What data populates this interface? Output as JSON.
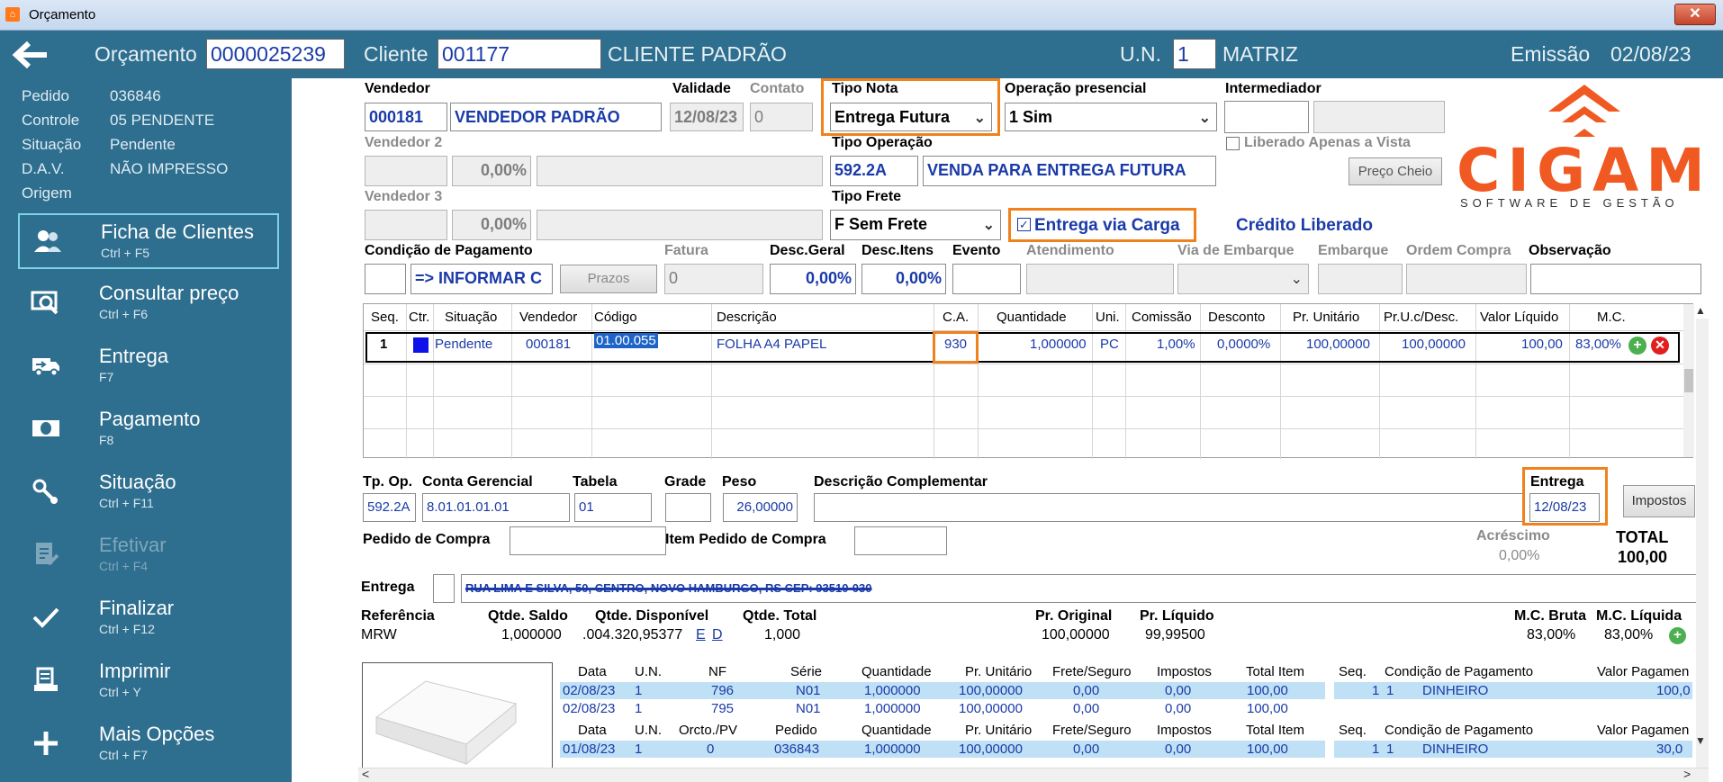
{
  "window": {
    "title": "Orçamento",
    "close": "✕"
  },
  "header": {
    "orcamento_label": "Orçamento",
    "orcamento_value": "0000025239",
    "cliente_label": "Cliente",
    "cliente_code": "001177",
    "cliente_name": "CLIENTE PADRÃO",
    "un_label": "U.N.",
    "un_value": "1",
    "un_name": "MATRIZ",
    "emissao_label": "Emissão",
    "emissao_value": "02/08/23"
  },
  "sidebar": {
    "info": [
      {
        "label": "Pedido",
        "value": "036846"
      },
      {
        "label": "Controle",
        "value": "05  PENDENTE"
      },
      {
        "label": "Situação",
        "value": "Pendente"
      },
      {
        "label": "D.A.V.",
        "value": "NÃO IMPRESSO"
      },
      {
        "label": "Origem",
        "value": ""
      }
    ],
    "menu": [
      {
        "title": "Ficha de Clientes",
        "key": "Ctrl + F5",
        "icon": "users-icon"
      },
      {
        "title": "Consultar preço",
        "key": "Ctrl + F6",
        "icon": "price-search-icon"
      },
      {
        "title": "Entrega",
        "key": "F7",
        "icon": "truck-icon"
      },
      {
        "title": "Pagamento",
        "key": "F8",
        "icon": "money-icon"
      },
      {
        "title": "Situação",
        "key": "Ctrl + F11",
        "icon": "status-icon"
      },
      {
        "title": "Efetivar",
        "key": "Ctrl + F4",
        "icon": "document-edit-icon"
      },
      {
        "title": "Finalizar",
        "key": "Ctrl + F12",
        "icon": "check-icon"
      },
      {
        "title": "Imprimir",
        "key": "Ctrl + Y",
        "icon": "printer-icon"
      },
      {
        "title": "Mais Opções",
        "key": "Ctrl + F7",
        "icon": "plus-icon"
      }
    ]
  },
  "form": {
    "vendedor_label": "Vendedor",
    "vendedor_code": "000181",
    "vendedor_name": "VENDEDOR PADRÃO",
    "validade_label": "Validade",
    "validade_value": "12/08/23",
    "contato_label": "Contato",
    "contato_value": "0",
    "tipo_nota_label": "Tipo Nota",
    "tipo_nota_value": "Entrega Futura",
    "operacao_label": "Operação presencial",
    "operacao_value": "1 Sim",
    "intermediador_label": "Intermediador",
    "vendedor2_label": "Vendedor 2",
    "vendedor2_pct": "0,00%",
    "tipo_operacao_label": "Tipo Operação",
    "tipo_operacao_code": "592.2A",
    "tipo_operacao_desc": "VENDA PARA ENTREGA FUTURA",
    "liberado_label": "Liberado Apenas a Vista",
    "preco_cheio": "Preço Cheio",
    "vendedor3_label": "Vendedor 3",
    "vendedor3_pct": "0,00%",
    "tipo_frete_label": "Tipo Frete",
    "tipo_frete_value": "F Sem Frete",
    "entrega_carga_label": "Entrega via Carga",
    "credito": "Crédito Liberado",
    "cond_pag_label": "Condição de Pagamento",
    "cond_pag_value": "=> INFORMAR C",
    "prazos": "Prazos",
    "fatura_label": "Fatura",
    "fatura_value": "0",
    "desc_geral_label": "Desc.Geral",
    "desc_geral_value": "0,00%",
    "desc_itens_label": "Desc.Itens",
    "desc_itens_value": "0,00%",
    "evento_label": "Evento",
    "atendimento_label": "Atendimento",
    "via_embarque_label": "Via de Embarque",
    "embarque_label": "Embarque",
    "ordem_compra_label": "Ordem Compra",
    "observacao_label": "Observação"
  },
  "logo": {
    "name": "CIGAM",
    "tagline": "SOFTWARE DE GESTÃO"
  },
  "grid": {
    "headers": [
      "Seq.",
      "Ctr.",
      "Situação",
      "Vendedor",
      "Código",
      "Descrição",
      "C.A.",
      "Quantidade",
      "Uni.",
      "Comissão",
      "Desconto",
      "Pr. Unitário",
      "Pr.U.c/Desc.",
      "Valor Líquido",
      "M.C."
    ],
    "rows": [
      {
        "seq": "1",
        "situacao": "Pendente",
        "vendedor": "000181",
        "codigo": "01.00.055",
        "descricao": "FOLHA A4 PAPEL",
        "ca": "930",
        "quantidade": "1,000000",
        "uni": "PC",
        "comissao": "1,00%",
        "desconto": "0,0000%",
        "pr_unit": "100,00000",
        "pr_desc": "100,00000",
        "valor": "100,00",
        "mc": "83,00%"
      }
    ]
  },
  "detail": {
    "tp_op_label": "Tp. Op.",
    "tp_op_value": "592.2A",
    "conta_label": "Conta Gerencial",
    "conta_value": "8.01.01.01.01",
    "tabela_label": "Tabela",
    "tabela_value": "01",
    "grade_label": "Grade",
    "peso_label": "Peso",
    "peso_value": "26,00000",
    "desc_comp_label": "Descrição Complementar",
    "entrega_label": "Entrega",
    "entrega_value": "12/08/23",
    "impostos": "Impostos",
    "pedido_compra_label": "Pedido de Compra",
    "item_pedido_label": "Item Pedido de Compra",
    "acrescimo_label": "Acréscimo",
    "acrescimo_value": "0,00%",
    "total_label": "TOTAL",
    "total_value": "100,00",
    "entrega_addr_label": "Entrega",
    "entrega_addr": "RUA LIMA E SILVA, 50, CENTRO, NOVO HAMBURGO, RS CEP: 93510-030",
    "referencia_label": "Referência",
    "referencia_value": "MRW",
    "qtde_saldo_label": "Qtde. Saldo",
    "qtde_saldo_value": "1,000000",
    "qtde_disp_label": "Qtde. Disponível",
    "qtde_disp_value": ".004.320,95377",
    "qtde_disp_e": "E",
    "qtde_disp_d": "D",
    "qtde_total_label": "Qtde. Total",
    "qtde_total_value": "1,000",
    "pr_original_label": "Pr. Original",
    "pr_original_value": "100,00000",
    "pr_liquido_label": "Pr. Líquido",
    "pr_liquido_value": "99,99500",
    "mc_bruta_label": "M.C. Bruta",
    "mc_bruta_value": "83,00%",
    "mc_liquida_label": "M.C. Líquida",
    "mc_liquida_value": "83,00%"
  },
  "history": {
    "h1": [
      "Data",
      "U.N.",
      "NF",
      "Série",
      "Quantidade",
      "Pr. Unitário",
      "Frete/Seguro",
      "Impostos",
      "Total Item"
    ],
    "r1": [
      [
        "02/08/23",
        "1",
        "796",
        "N01",
        "1,000000",
        "100,00000",
        "0,00",
        "0,00",
        "100,00"
      ],
      [
        "02/08/23",
        "1",
        "795",
        "N01",
        "1,000000",
        "100,00000",
        "0,00",
        "0,00",
        "100,00"
      ]
    ],
    "h2": [
      "Data",
      "U.N.",
      "Orcto./PV",
      "Pedido",
      "Quantidade",
      "Pr. Unitário",
      "Frete/Seguro",
      "Impostos",
      "Total Item"
    ],
    "r2": [
      [
        "01/08/23",
        "1",
        "0",
        "036843",
        "1,000000",
        "100,00000",
        "0,00",
        "0,00",
        "100,00"
      ]
    ],
    "ph": [
      "Seq.",
      "Condição de Pagamento",
      "Valor Pagamen"
    ],
    "p1": [
      "1",
      "1",
      "DINHEIRO",
      "100,0"
    ],
    "p2": [
      "1",
      "1",
      "DINHEIRO",
      "30,0"
    ]
  }
}
